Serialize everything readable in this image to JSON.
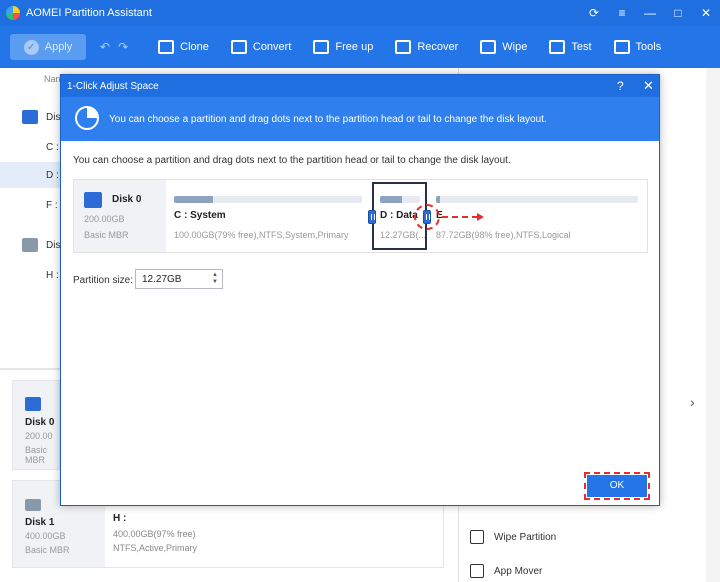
{
  "app": {
    "title": "AOMEI Partition Assistant"
  },
  "window_controls": [
    "⟳",
    "≡",
    "—",
    "□",
    "✕"
  ],
  "toolbar": {
    "apply": "Apply",
    "undo": "↶",
    "redo": "↷",
    "tools": [
      {
        "label": "Clone",
        "icon": "clone-icon"
      },
      {
        "label": "Convert",
        "icon": "convert-icon"
      },
      {
        "label": "Free up",
        "icon": "free-up-icon"
      },
      {
        "label": "Recover",
        "icon": "recover-icon"
      },
      {
        "label": "Wipe",
        "icon": "wipe-icon"
      },
      {
        "label": "Test",
        "icon": "test-icon"
      },
      {
        "label": "Tools",
        "icon": "tools-icon"
      }
    ]
  },
  "background": {
    "list_header": "Nan",
    "rows": [
      {
        "label": "Dis",
        "type": "disk"
      },
      {
        "label": "C :",
        "type": "partition"
      },
      {
        "label": "D :",
        "type": "partition",
        "selected": true
      },
      {
        "label": "F :",
        "type": "partition"
      },
      {
        "label": "Dis",
        "type": "disk"
      },
      {
        "label": "H :",
        "type": "partition"
      }
    ],
    "disk0_card": {
      "name": "Disk 0",
      "size": "200.00",
      "type": "Basic MBR"
    },
    "disk1_card": {
      "name": "Disk 1",
      "size": "400.00GB",
      "type": "Basic MBR",
      "partition_name": "H :",
      "partition_info_1": "400.00GB(97% free)",
      "partition_info_2": "NTFS,Active,Primary"
    },
    "right_items": [
      {
        "label": "Wipe Partition",
        "icon": "wipe-partition-icon"
      },
      {
        "label": "App Mover",
        "icon": "app-mover-icon"
      }
    ],
    "right_chevron": "›"
  },
  "dialog": {
    "title": "1-Click Adjust Space",
    "help": "?",
    "close": "✕",
    "banner_text": "You can choose a partition and drag dots next to the partition head or tail to change the disk layout.",
    "description": "You can choose a partition and drag dots next to the partition head or tail to change the disk layout.",
    "disk": {
      "name": "Disk 0",
      "size": "200.00GB",
      "type": "Basic MBR"
    },
    "partitions": [
      {
        "name": "C : System",
        "info": "100.00GB(79% free),NTFS,System,Primary",
        "used_fraction": 0.21
      },
      {
        "name": "D : Data",
        "info": "12.27GB(...",
        "used_fraction": 0.55
      },
      {
        "name": "E",
        "info": "87.72GB(98% free),NTFS,Logical",
        "used_fraction": 0.02
      }
    ],
    "partition_size_label": "Partition size:",
    "partition_size_value": "12.27GB",
    "ok": "OK",
    "colors": {
      "accent": "#1f6fe0",
      "highlight": "#e23030"
    }
  }
}
